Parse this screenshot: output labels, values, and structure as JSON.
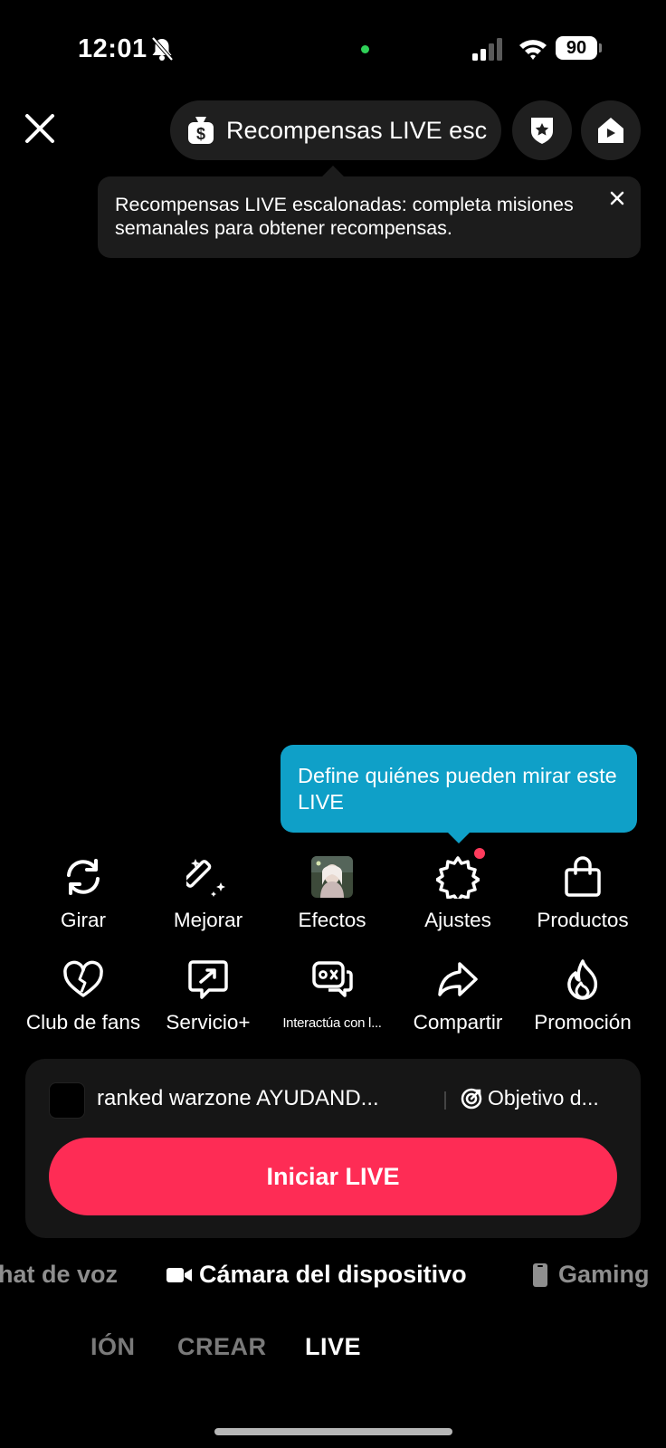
{
  "status_bar": {
    "time": "12:01",
    "battery": "90",
    "colors": {
      "camera_dot": "#2fd158"
    }
  },
  "top_bar": {
    "rewards_pill_label": "Recompensas LIVE esc",
    "icons": [
      "close-icon",
      "dollar-bag-icon",
      "star-shield-icon",
      "home-play-icon"
    ]
  },
  "rewards_tooltip": {
    "text": "Recompensas LIVE escalonadas: completa misiones semanales para obtener recompensas."
  },
  "audience_tooltip": {
    "text": "Define quiénes pueden mirar este LIVE"
  },
  "tools_row1": [
    {
      "label": "Girar",
      "icon": "rotate-icon"
    },
    {
      "label": "Mejorar",
      "icon": "magic-wand-icon"
    },
    {
      "label": "Efectos",
      "icon": "effect-thumbnail"
    },
    {
      "label": "Ajustes",
      "icon": "gear-icon"
    },
    {
      "label": "Productos",
      "icon": "shopping-bag-icon"
    }
  ],
  "tools_row2": [
    {
      "label": "Club de fans",
      "icon": "heart-icon"
    },
    {
      "label": "Servicio+",
      "icon": "service-icon"
    },
    {
      "label": "Interactúa con l...",
      "icon": "game-chat-icon"
    },
    {
      "label": "Compartir",
      "icon": "share-icon"
    },
    {
      "label": "Promoción",
      "icon": "flame-icon"
    }
  ],
  "live_panel": {
    "title": "ranked warzone AYUDAND...",
    "goal_label": "Objetivo d...",
    "start_button": "Iniciar LIVE"
  },
  "sources": {
    "left": "hat de voz",
    "center": "Cámara del dispositivo",
    "right": "Gaming"
  },
  "modes": {
    "left": "IÓN",
    "middle": "CREAR",
    "active": "LIVE"
  },
  "colors": {
    "accent_red": "#fe2c55",
    "tooltip_blue": "#0fa0c8",
    "badge_red": "#ff3b5c"
  }
}
